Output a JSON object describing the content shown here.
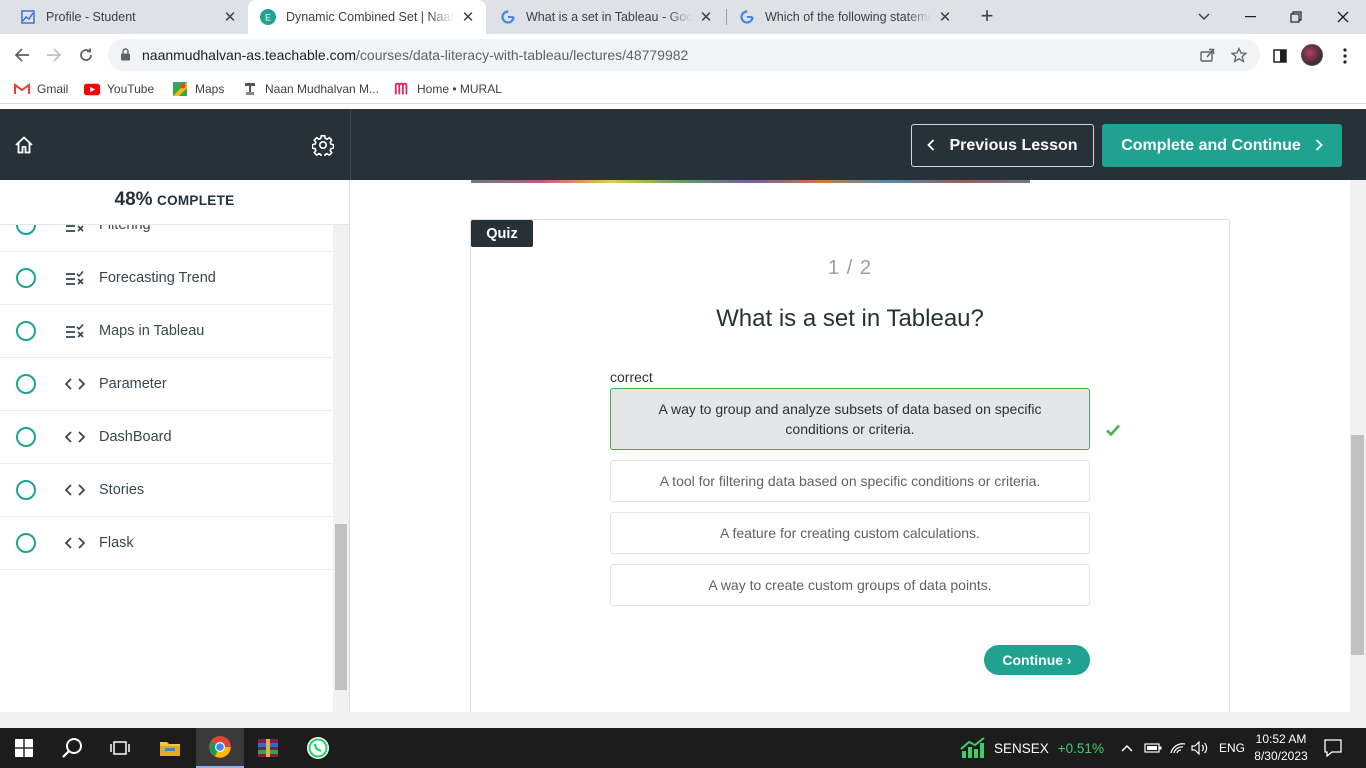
{
  "browser": {
    "tabs": [
      {
        "title": "Profile - Student",
        "active": false
      },
      {
        "title": "Dynamic Combined Set | NaanMudhalvan",
        "active": true
      },
      {
        "title": "What is a set in Tableau - Google Search",
        "active": false
      },
      {
        "title": "Which of the following statements",
        "active": false
      }
    ],
    "new_tab": "+",
    "url_host": "naanmudhalvan-as.teachable.com",
    "url_path": "/courses/data-literacy-with-tableau/lectures/48779982",
    "bookmarks": [
      {
        "label": "Gmail",
        "icon": "gmail-icon"
      },
      {
        "label": "YouTube",
        "icon": "youtube-icon"
      },
      {
        "label": "Maps",
        "icon": "maps-icon"
      },
      {
        "label": "Naan Mudhalvan M...",
        "icon": "naan-mudhalvan-icon"
      },
      {
        "label": "Home • MURAL",
        "icon": "mural-icon"
      }
    ]
  },
  "header": {
    "prev_label": "Previous Lesson",
    "next_label": "Complete and Continue"
  },
  "sidebar": {
    "percent": "48%",
    "complete_word": "COMPLETE",
    "lessons": [
      {
        "name": "Filtering",
        "type": "quiz"
      },
      {
        "name": "Forecasting Trend",
        "type": "quiz"
      },
      {
        "name": "Maps in Tableau",
        "type": "quiz"
      },
      {
        "name": "Parameter",
        "type": "code"
      },
      {
        "name": "DashBoard",
        "type": "code"
      },
      {
        "name": "Stories",
        "type": "code"
      },
      {
        "name": "Flask",
        "type": "code"
      }
    ]
  },
  "quiz": {
    "tag": "Quiz",
    "counter": "1 / 2",
    "question": "What is a set in Tableau?",
    "result_label": "correct",
    "answers": [
      {
        "text": "A way to group and analyze subsets of data based on specific conditions or criteria.",
        "selected": true
      },
      {
        "text": "A tool for filtering data based on specific conditions or criteria.",
        "selected": false
      },
      {
        "text": "A feature for creating custom calculations.",
        "selected": false
      },
      {
        "text": "A way to create custom groups of data points.",
        "selected": false
      }
    ],
    "continue_label": "Continue ›"
  },
  "taskbar": {
    "sensex_label": "SENSEX",
    "sensex_change": "+0.51%",
    "language": "ENG",
    "time": "10:52 AM",
    "date": "8/30/2023"
  },
  "colors": {
    "accent": "#1fa28f",
    "header_bg": "#263238",
    "correct_border": "#4caf50"
  }
}
